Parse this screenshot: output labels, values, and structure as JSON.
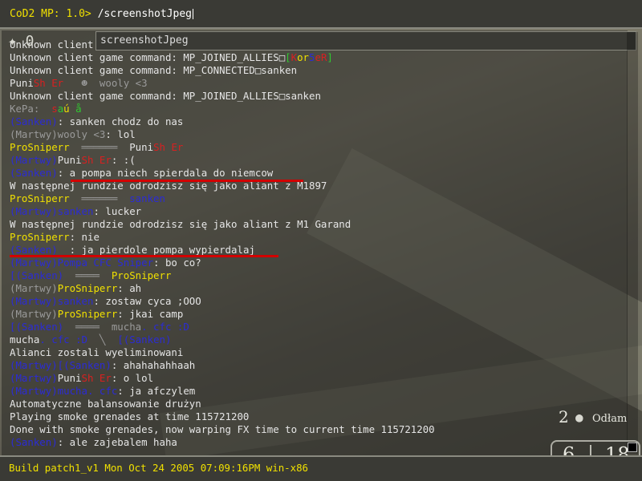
{
  "console": {
    "prompt": "CoD2 MP: 1.0>",
    "input_value": "/screenshotJpeg",
    "autocomplete": "screenshotJpeg",
    "status": "Build patch1_v1 Mon Oct 24 2005 07:09:16PM win-x86"
  },
  "hud": {
    "compass": "✦ 0",
    "grenade_count": "2",
    "grenade_label": "Odłam",
    "ammo_current": "6",
    "ammo_max": "18"
  },
  "colors": {
    "prompt_yellow": "#f0e000",
    "underline_red": "#d20000",
    "team_blue": "#2b2bd6"
  },
  "log": [
    [
      {
        "t": "Unknown client",
        "c": "w"
      }
    ],
    [
      {
        "t": "Unknown client game command: MP_JOINED_ALLIES□",
        "c": "w"
      },
      {
        "t": "[",
        "c": "g"
      },
      {
        "t": "K",
        "c": "r"
      },
      {
        "t": "or",
        "c": "y"
      },
      {
        "t": "5",
        "c": "b"
      },
      {
        "t": "eR",
        "c": "r"
      },
      {
        "t": "]",
        "c": "g"
      }
    ],
    [
      {
        "t": "Unknown client game command: MP_CONNECTED□sanken",
        "c": "w"
      }
    ],
    [
      {
        "t": "Puni",
        "c": "w"
      },
      {
        "t": "Sh",
        "c": "r"
      },
      {
        "t": " Er",
        "c": "r"
      },
      {
        "t": "   ☻  wooly <3",
        "c": "gr"
      }
    ],
    [
      {
        "t": "Unknown client game command: MP_JOINED_ALLIES□sanken",
        "c": "w"
      }
    ],
    [
      {
        "t": "KePa:",
        "c": "gr"
      },
      {
        "t": "  ",
        "c": "w"
      },
      {
        "t": "s",
        "c": "r"
      },
      {
        "t": "a",
        "c": "g"
      },
      {
        "t": "ú ",
        "c": "y"
      },
      {
        "t": "å",
        "c": "g"
      }
    ],
    [
      {
        "t": "(Sanken)",
        "c": "b"
      },
      {
        "t": ": sanken chodz do nas",
        "c": "w"
      }
    ],
    [
      {
        "t": "(Martwy)wooly <3",
        "c": "gr"
      },
      {
        "t": ": lol",
        "c": "w"
      }
    ],
    [
      {
        "t": "ProSniperr",
        "c": "y"
      },
      {
        "t": "  ══════  ",
        "c": "gr"
      },
      {
        "t": "Puni",
        "c": "w"
      },
      {
        "t": "Sh Er",
        "c": "r"
      }
    ],
    [
      {
        "t": "(Martwy)",
        "c": "b"
      },
      {
        "t": "Puni",
        "c": "w"
      },
      {
        "t": "Sh Er",
        "c": "r"
      },
      {
        "t": ": :(",
        "c": "w"
      }
    ],
    [
      {
        "t": "(Sanken)",
        "c": "b"
      },
      {
        "t": ": a pompa niech spierdala do niemcow",
        "c": "w"
      }
    ],
    [
      {
        "t": "W następnej rundzie odrodzisz się jako aliant z M1897",
        "c": "w"
      }
    ],
    [
      {
        "t": "ProSniperr",
        "c": "y"
      },
      {
        "t": "  ══════  ",
        "c": "gr"
      },
      {
        "t": "sanken",
        "c": "b"
      }
    ],
    [
      {
        "t": "(Martwy)sanken",
        "c": "b"
      },
      {
        "t": ": lucker",
        "c": "w"
      }
    ],
    [
      {
        "t": "W następnej rundzie odrodzisz się jako aliant z M1 Garand",
        "c": "w"
      }
    ],
    [
      {
        "t": "ProSniperr",
        "c": "y"
      },
      {
        "t": ": nie",
        "c": "w"
      }
    ],
    [
      {
        "t": "(Sanken)",
        "c": "b"
      },
      {
        "t": "  : ja pierdole pompa wypierdalaj",
        "c": "w"
      }
    ],
    [
      {
        "t": "(Martwy)Pompa CFC Sniper",
        "c": "b"
      },
      {
        "t": ": bo co?",
        "c": "w"
      }
    ],
    [
      {
        "t": "[(Sanken)",
        "c": "b"
      },
      {
        "t": "  ════  ",
        "c": "gr"
      },
      {
        "t": "ProSniperr",
        "c": "y"
      }
    ],
    [
      {
        "t": "(Martwy)",
        "c": "gr"
      },
      {
        "t": "ProSniperr",
        "c": "y"
      },
      {
        "t": ": ah",
        "c": "w"
      }
    ],
    [
      {
        "t": "(Martwy)sanken",
        "c": "b"
      },
      {
        "t": ": zostaw cyca ;OOO",
        "c": "w"
      }
    ],
    [
      {
        "t": "(Martwy)",
        "c": "gr"
      },
      {
        "t": "ProSniperr",
        "c": "y"
      },
      {
        "t": ": jkai camp",
        "c": "w"
      }
    ],
    [
      {
        "t": "[(Sanken)",
        "c": "b"
      },
      {
        "t": "  ════  ",
        "c": "gr"
      },
      {
        "t": "mucha",
        "c": "gr"
      },
      {
        "t": ". cfc :D",
        "c": "b"
      }
    ],
    [
      {
        "t": "mucha",
        "c": "w"
      },
      {
        "t": ". cfc :D",
        "c": "b"
      },
      {
        "t": "  ╲  ",
        "c": "gr"
      },
      {
        "t": "[(Sanken)",
        "c": "b"
      }
    ],
    [
      {
        "t": "Alianci zostali wyeliminowani",
        "c": "w"
      }
    ],
    [
      {
        "t": "(Martwy)[(Sanken)",
        "c": "b"
      },
      {
        "t": ": ahahahahhaah",
        "c": "w"
      }
    ],
    [
      {
        "t": "(Martwy)",
        "c": "b"
      },
      {
        "t": "Puni",
        "c": "w"
      },
      {
        "t": "Sh Er",
        "c": "r"
      },
      {
        "t": ": o lol",
        "c": "w"
      }
    ],
    [
      {
        "t": "(Martwy)mucha. cfc",
        "c": "b"
      },
      {
        "t": ": ja afczylem",
        "c": "w"
      }
    ],
    [
      {
        "t": "Automatyczne balansowanie drużyn",
        "c": "w"
      }
    ],
    [
      {
        "t": "Playing smoke grenades at time 115721200",
        "c": "w"
      }
    ],
    [
      {
        "t": "Done with smoke grenades, now warping FX time to current time 115721200",
        "c": "w"
      }
    ],
    [
      {
        "t": "(Sanken)",
        "c": "b"
      },
      {
        "t": ": ale zajebalem haha",
        "c": "w"
      }
    ]
  ]
}
